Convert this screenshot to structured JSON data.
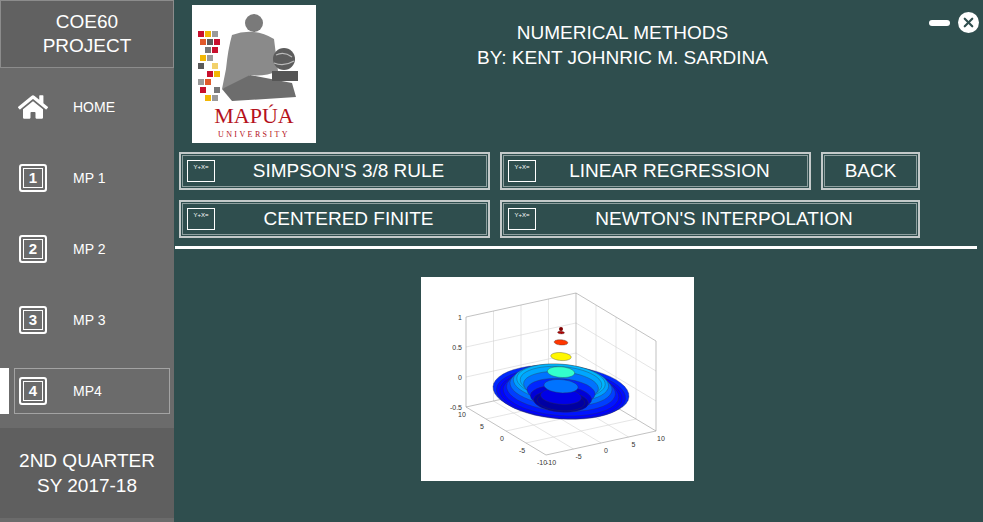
{
  "window": {
    "title": "NUMERICAL METHODS",
    "subtitle": "BY: KENT JOHNRIC M. SARDINA"
  },
  "sidebar": {
    "header": [
      "COE60",
      "PROJECT"
    ],
    "items": [
      {
        "label": "HOME",
        "kind": "home",
        "selected": false
      },
      {
        "label": "MP 1",
        "kind": "number",
        "badge": "1",
        "selected": false
      },
      {
        "label": "MP 2",
        "kind": "number",
        "badge": "2",
        "selected": false
      },
      {
        "label": "MP 3",
        "kind": "number",
        "badge": "3",
        "selected": false
      },
      {
        "label": "MP4",
        "kind": "number",
        "badge": "4",
        "selected": true
      }
    ],
    "footer": [
      "2ND QUARTER",
      "SY 2017-18"
    ]
  },
  "logo": {
    "name": "MAPÚA",
    "sub": "UNIVERSITY"
  },
  "buttons": [
    {
      "label": "SIMPSON'S 3/8 RULE",
      "kind": "method",
      "icon_text": "Y+X="
    },
    {
      "label": "LINEAR REGRESSION",
      "kind": "method",
      "icon_text": "Y+X="
    },
    {
      "label": "BACK",
      "kind": "plain"
    },
    {
      "label": "CENTERED FINITE",
      "kind": "method",
      "icon_text": "Y+X="
    },
    {
      "label": "NEWTON'S INTERPOLATION",
      "kind": "method",
      "icon_text": "Y+X="
    }
  ],
  "chart": {
    "z_ticks": [
      "1",
      "0.5",
      "0",
      "-0.5"
    ],
    "x_ticks": [
      "10",
      "5",
      "0",
      "-5",
      "-10"
    ],
    "y_ticks": [
      "-10",
      "-5",
      "0",
      "5",
      "10"
    ],
    "series": [
      1,
      0.941,
      0.777,
      0.541,
      0.281,
      0.047,
      -0.123,
      -0.208,
      -0.208,
      -0.143,
      -0.047,
      0.047,
      0.11,
      0.128,
      0.102,
      0.046,
      -0.018,
      -0.069,
      -0.091,
      -0.081,
      -0.045
    ]
  }
}
